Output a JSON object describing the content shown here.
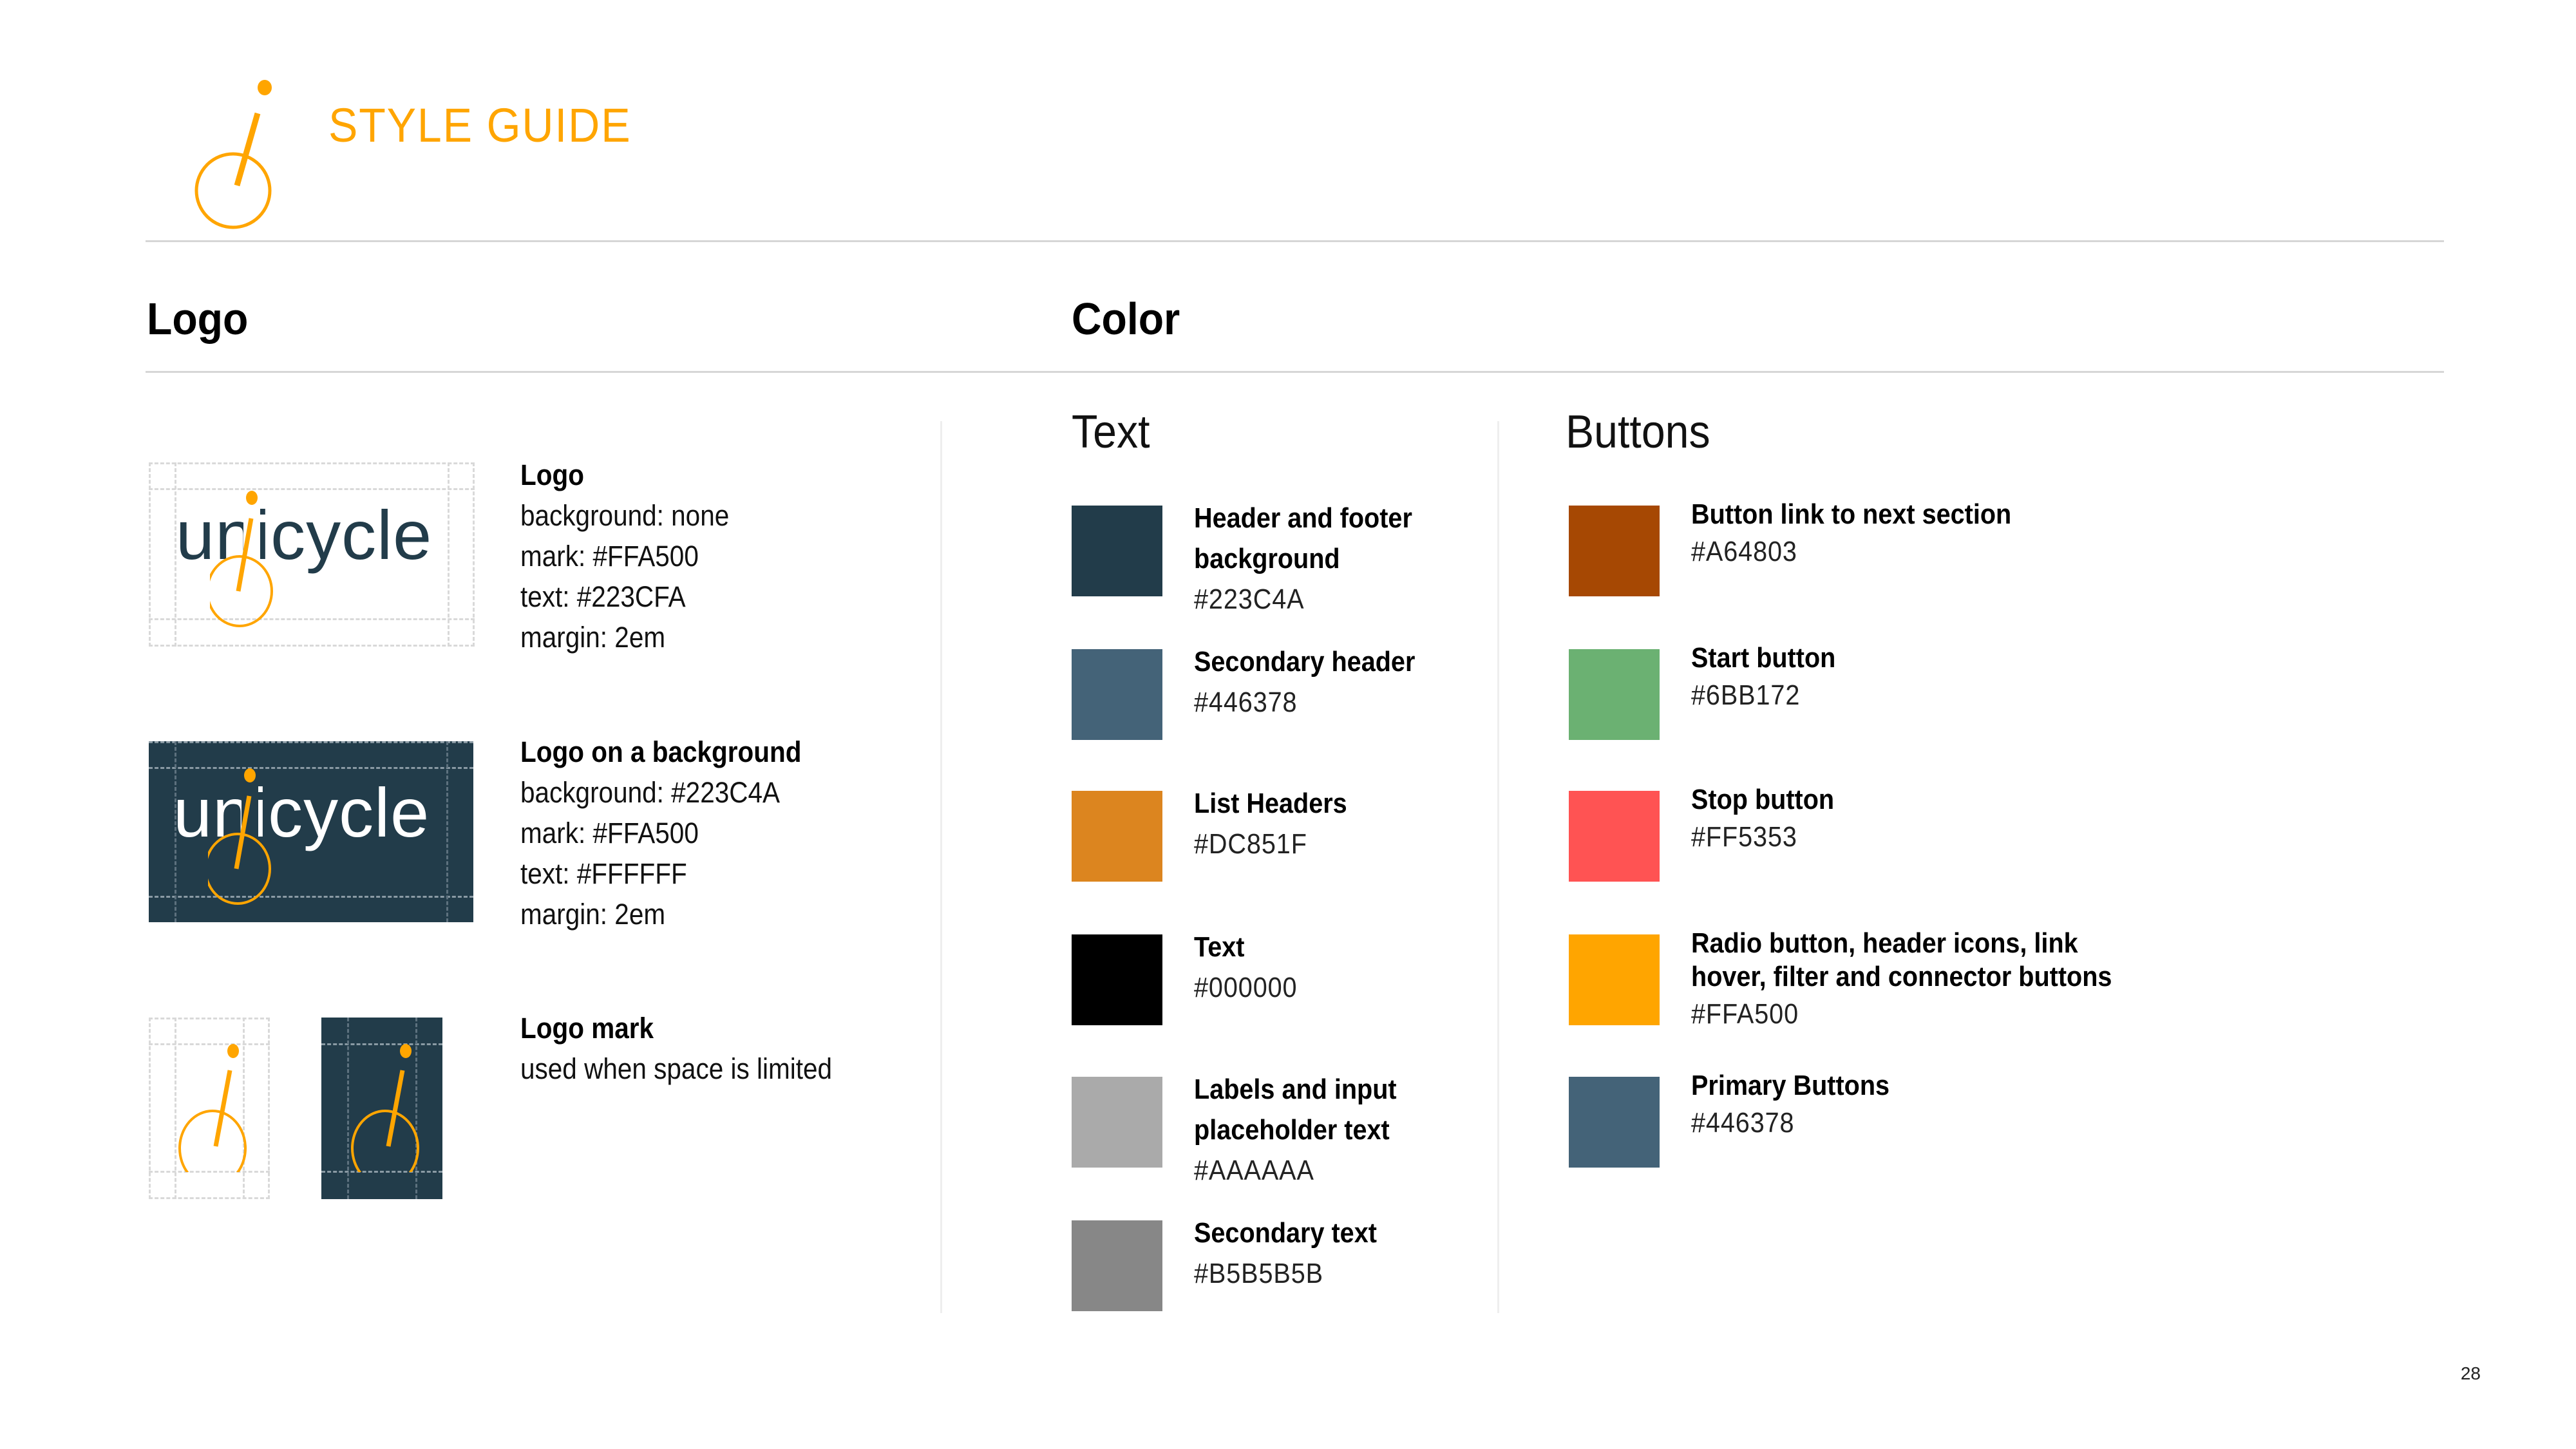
{
  "header": {
    "title": "STYLE GUIDE",
    "logo_icon": "unicycle-mark-icon"
  },
  "sections": {
    "logo": {
      "heading": "Logo",
      "items": [
        {
          "title": "Logo",
          "lines": [
            "background: none",
            "mark: #FFA500",
            "text: #223CFA",
            "margin: 2em"
          ],
          "wordmark": "unicycle"
        },
        {
          "title": "Logo on a background",
          "lines": [
            "background: #223C4A",
            "mark: #FFA500",
            "text: #FFFFFF",
            "margin: 2em"
          ],
          "wordmark": "unicycle"
        },
        {
          "title": "Logo mark",
          "lines": [
            "used when space is limited"
          ]
        }
      ]
    },
    "color": {
      "heading": "Color",
      "text_group": {
        "heading": "Text",
        "swatches": [
          {
            "name_lines": [
              "Header and footer",
              "background"
            ],
            "hex": "#223C4A",
            "color": "#223C4A"
          },
          {
            "name_lines": [
              "Secondary header"
            ],
            "hex": "#446378",
            "color": "#446378"
          },
          {
            "name_lines": [
              "List Headers"
            ],
            "hex": "#DC851F",
            "color": "#DC851F"
          },
          {
            "name_lines": [
              "Text"
            ],
            "hex": "#000000",
            "color": "#000000"
          },
          {
            "name_lines": [
              "Labels and input",
              "placeholder text"
            ],
            "hex": "#AAAAAA",
            "color": "#AAAAAA"
          },
          {
            "name_lines": [
              "Secondary text"
            ],
            "hex": "#B5B5B5B",
            "color": "#878787"
          }
        ]
      },
      "buttons_group": {
        "heading": "Buttons",
        "swatches": [
          {
            "name_lines": [
              "Button link to next section"
            ],
            "hex": "#A64803",
            "color": "#A64803"
          },
          {
            "name_lines": [
              "Start button"
            ],
            "hex": "#6BB172",
            "color": "#6BB172"
          },
          {
            "name_lines": [
              "Stop button"
            ],
            "hex": "#FF5353",
            "color": "#FF5353"
          },
          {
            "name_lines": [
              "Radio button, header icons, link",
              "hover, filter and connector buttons"
            ],
            "hex": "#FFA500",
            "color": "#FFA500"
          },
          {
            "name_lines": [
              "Primary Buttons"
            ],
            "hex": "#446378",
            "color": "#446378"
          }
        ]
      }
    }
  },
  "colors": {
    "accent": "#FFA500",
    "dark_bg": "#223C4A",
    "wordmark_text": "#223C4A",
    "rule": "#D6D6D6"
  },
  "footer": {
    "page_number": "28"
  }
}
